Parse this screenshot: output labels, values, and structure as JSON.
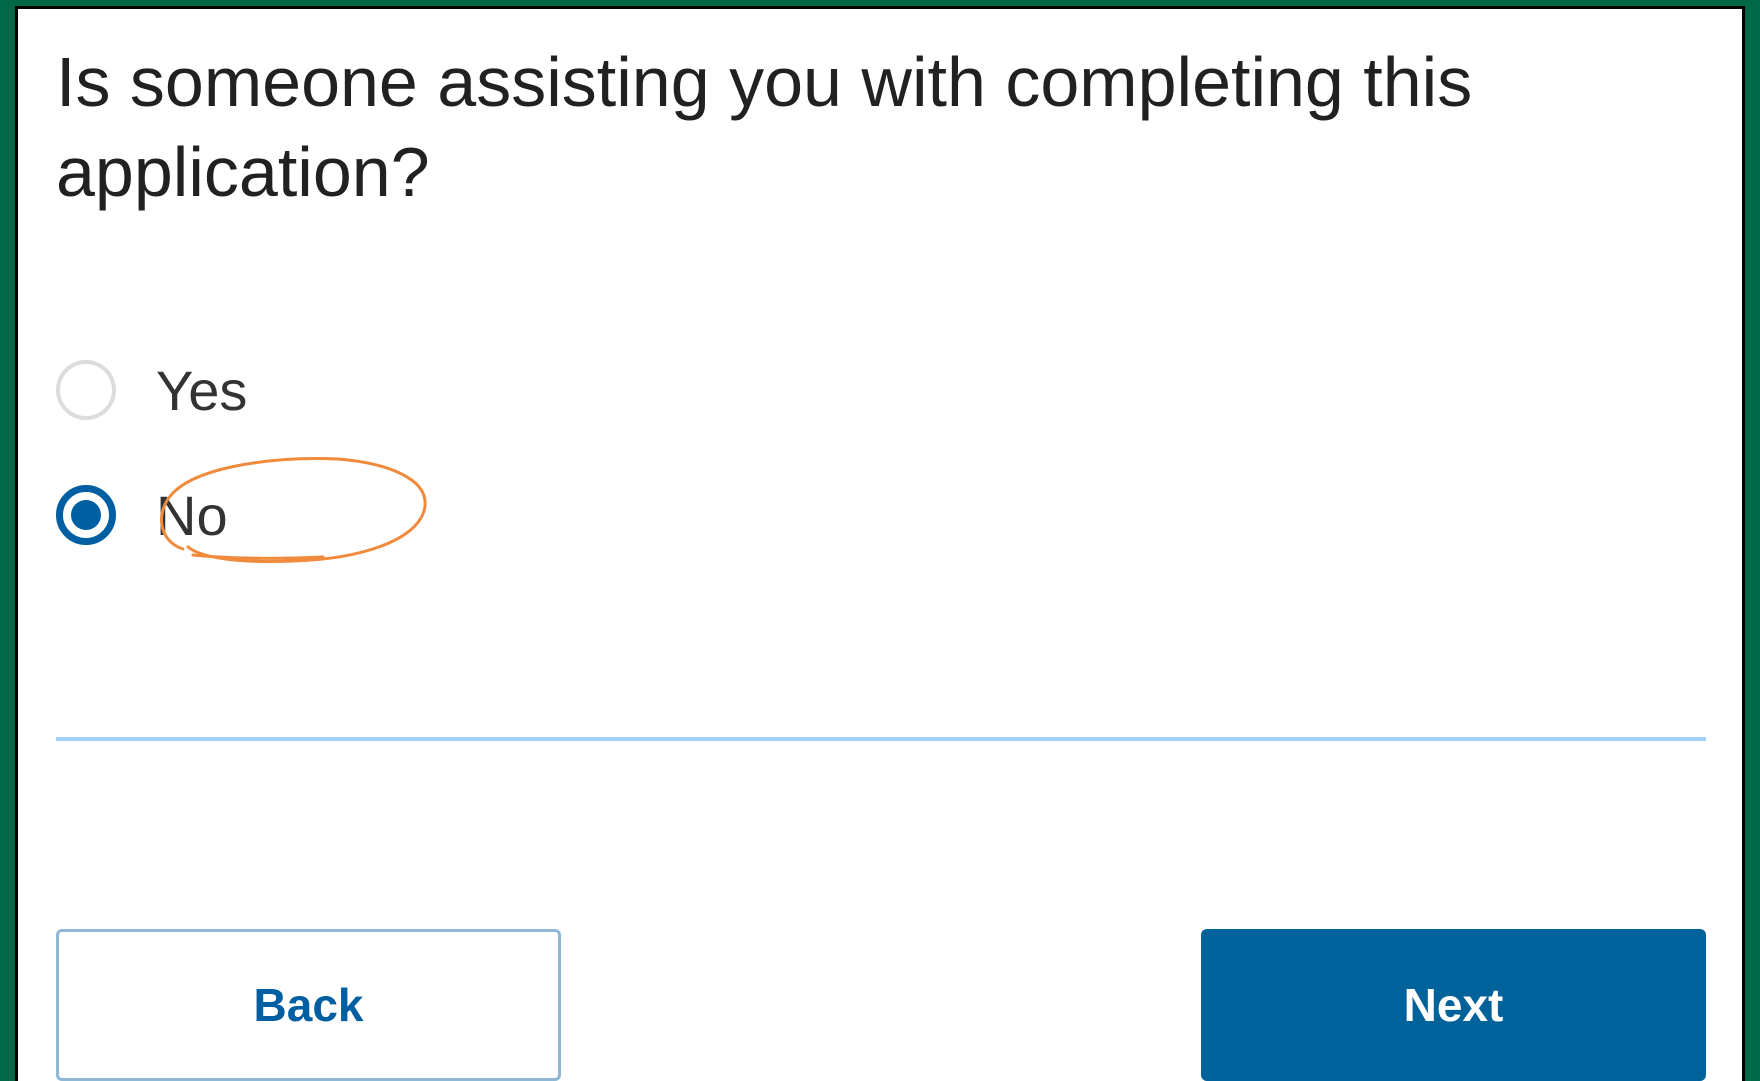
{
  "form": {
    "question": "Is someone assisting you with completing this application?",
    "options": [
      {
        "label": "Yes",
        "selected": false
      },
      {
        "label": "No",
        "selected": true
      }
    ],
    "selected_value": "No"
  },
  "buttons": {
    "back_label": "Back",
    "next_label": "Next"
  },
  "colors": {
    "frame_border": "#006747",
    "primary": "#00629b",
    "radio_selected": "#005ea2",
    "divider": "#9fd2f5",
    "annotation": "#f08a3c"
  }
}
